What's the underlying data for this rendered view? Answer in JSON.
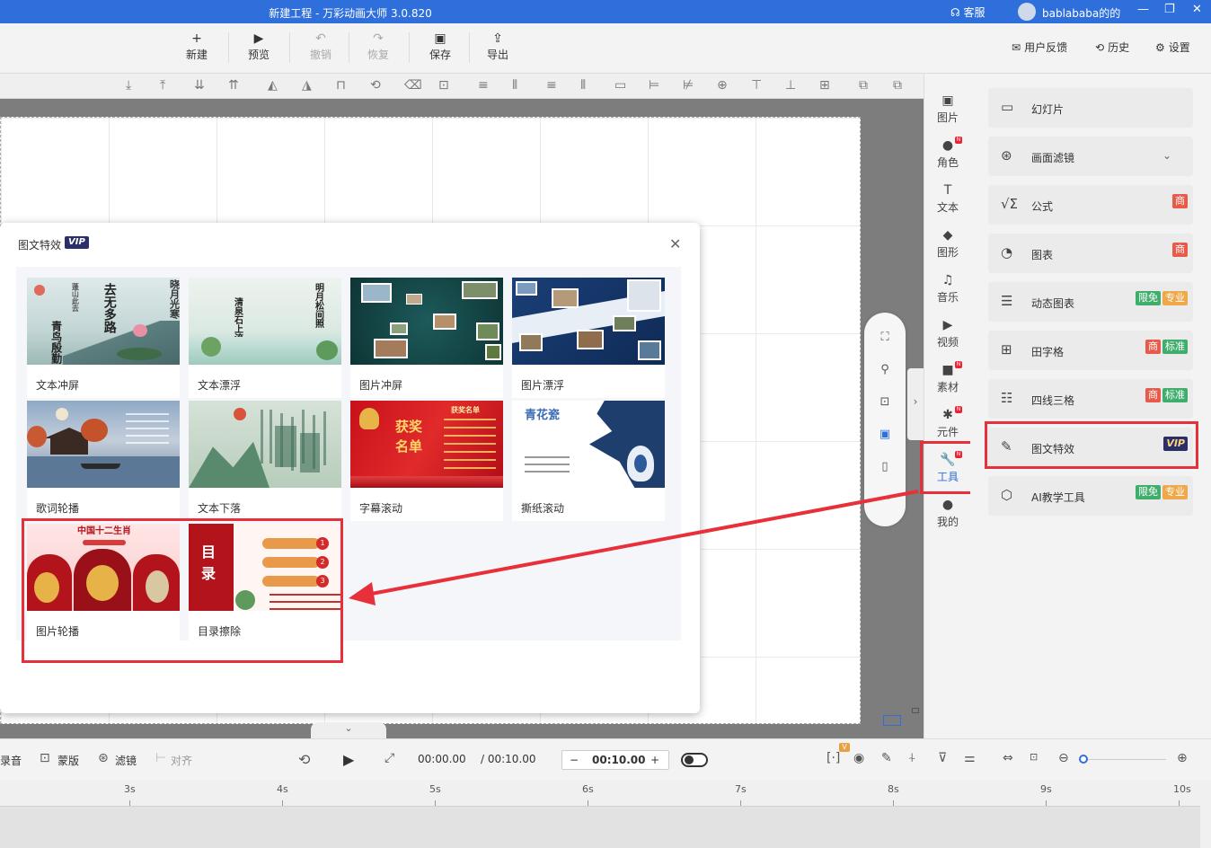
{
  "app": {
    "title": "新建工程 - 万彩动画大师 3.0.820",
    "service": "客服",
    "username": "bablababa的的",
    "window": {
      "minimize": "—",
      "restore": "❐",
      "close": "✕"
    }
  },
  "toolbar": {
    "buttons": [
      {
        "label": "新建",
        "icon": "+"
      },
      {
        "label": "预览",
        "icon": "▶"
      },
      {
        "label": "撤销",
        "icon": "↶"
      },
      {
        "label": "恢复",
        "icon": "↷"
      },
      {
        "label": "保存",
        "icon": "▣"
      },
      {
        "label": "导出",
        "icon": "⇪"
      }
    ],
    "right": [
      {
        "label": "用户反馈",
        "icon": "✉"
      },
      {
        "label": "历史",
        "icon": "⟲"
      },
      {
        "label": "设置",
        "icon": "⚙"
      }
    ]
  },
  "align_icons": [
    "⤓",
    "⤒",
    "⇊",
    "⇈",
    "◭",
    "◮",
    "⊓",
    "⟲",
    "⌫",
    "⊡",
    "≡",
    "⦀",
    "≡",
    "⦀",
    "▭",
    "⊨",
    "⊭",
    "⊕",
    "⊤",
    "⊥",
    "⊞",
    "⧉",
    "⧉"
  ],
  "floatpanel": [
    "⛶",
    "⚲",
    "⊡",
    "▣",
    "▯",
    "⋯"
  ],
  "sidebar": [
    {
      "label": "图片",
      "icon": "▣",
      "new": false
    },
    {
      "label": "角色",
      "icon": "●",
      "new": true
    },
    {
      "label": "文本",
      "icon": "T",
      "new": false
    },
    {
      "label": "图形",
      "icon": "◆",
      "new": false
    },
    {
      "label": "音乐",
      "icon": "♫",
      "new": false
    },
    {
      "label": "视频",
      "icon": "▶",
      "new": false
    },
    {
      "label": "素材",
      "icon": "■",
      "new": true
    },
    {
      "label": "元件",
      "icon": "✱",
      "new": true
    },
    {
      "label": "工具",
      "icon": "🔧",
      "new": true
    },
    {
      "label": "我的",
      "icon": "●",
      "new": false
    }
  ],
  "tools": [
    {
      "label": "幻灯片",
      "icon": "▭",
      "badges": []
    },
    {
      "label": "画面滤镜",
      "icon": "⊛",
      "badges": [],
      "chevron": "⌄"
    },
    {
      "label": "公式",
      "icon": "√Σ",
      "badges": [
        {
          "text": "商",
          "color": "red"
        }
      ]
    },
    {
      "label": "图表",
      "icon": "◔",
      "badges": [
        {
          "text": "商",
          "color": "red"
        }
      ]
    },
    {
      "label": "动态图表",
      "icon": "☰",
      "badges": [
        {
          "text": "限免",
          "color": "green"
        },
        {
          "text": "专业",
          "color": "orange"
        }
      ]
    },
    {
      "label": "田字格",
      "icon": "⊞",
      "badges": [
        {
          "text": "商",
          "color": "red"
        },
        {
          "text": "标准",
          "color": "green"
        }
      ]
    },
    {
      "label": "四线三格",
      "icon": "☷",
      "badges": [
        {
          "text": "商",
          "color": "red"
        },
        {
          "text": "标准",
          "color": "green"
        }
      ]
    },
    {
      "label": "图文特效",
      "icon": "✎",
      "badges": [
        {
          "text": "VIP",
          "color": "vip"
        }
      ]
    },
    {
      "label": "AI教学工具",
      "icon": "⬡",
      "badges": [
        {
          "text": "限免",
          "color": "green"
        },
        {
          "text": "专业",
          "color": "orange"
        }
      ]
    }
  ],
  "dialog": {
    "title": "图文特效",
    "vip": "VIP",
    "close": "✕",
    "cards": [
      {
        "label": "文本冲屏",
        "thumb_texts": [
          "去无多路",
          "青鸟殷勤",
          "蓬山此去",
          "晓月光寒"
        ]
      },
      {
        "label": "文本漂浮",
        "thumb_texts": [
          "明月松间照",
          "清泉石上流"
        ]
      },
      {
        "label": "图片冲屏",
        "thumb_texts": []
      },
      {
        "label": "图片漂浮",
        "thumb_texts": []
      },
      {
        "label": "歌词轮播",
        "thumb_texts": []
      },
      {
        "label": "文本下落",
        "thumb_texts": []
      },
      {
        "label": "字幕滚动",
        "thumb_texts": [
          "获奖",
          "名单",
          "获奖名单"
        ]
      },
      {
        "label": "撕纸滚动",
        "thumb_texts": [
          "青花瓷"
        ]
      },
      {
        "label": "图片轮播",
        "thumb_texts": [
          "中国十二生肖"
        ]
      },
      {
        "label": "目录擦除",
        "thumb_texts": [
          "目",
          "录",
          "1",
          "2",
          "3"
        ]
      }
    ]
  },
  "playbar": {
    "record": "录音",
    "mask": "蒙版",
    "filter": "滤镜",
    "align": "对齐",
    "current_time": "00:00.00",
    "total_time": "/ 00:10.00",
    "duration": "00:10.00",
    "minus": "−",
    "plus": "+",
    "v_badge": "V"
  },
  "timeline": {
    "ticks": [
      "3s",
      "4s",
      "5s",
      "6s",
      "7s",
      "8s",
      "9s",
      "10s"
    ]
  },
  "colors": {
    "titlebar": "#2f6fdc",
    "highlight": "#e8303a",
    "active": "#2f6fdc"
  }
}
